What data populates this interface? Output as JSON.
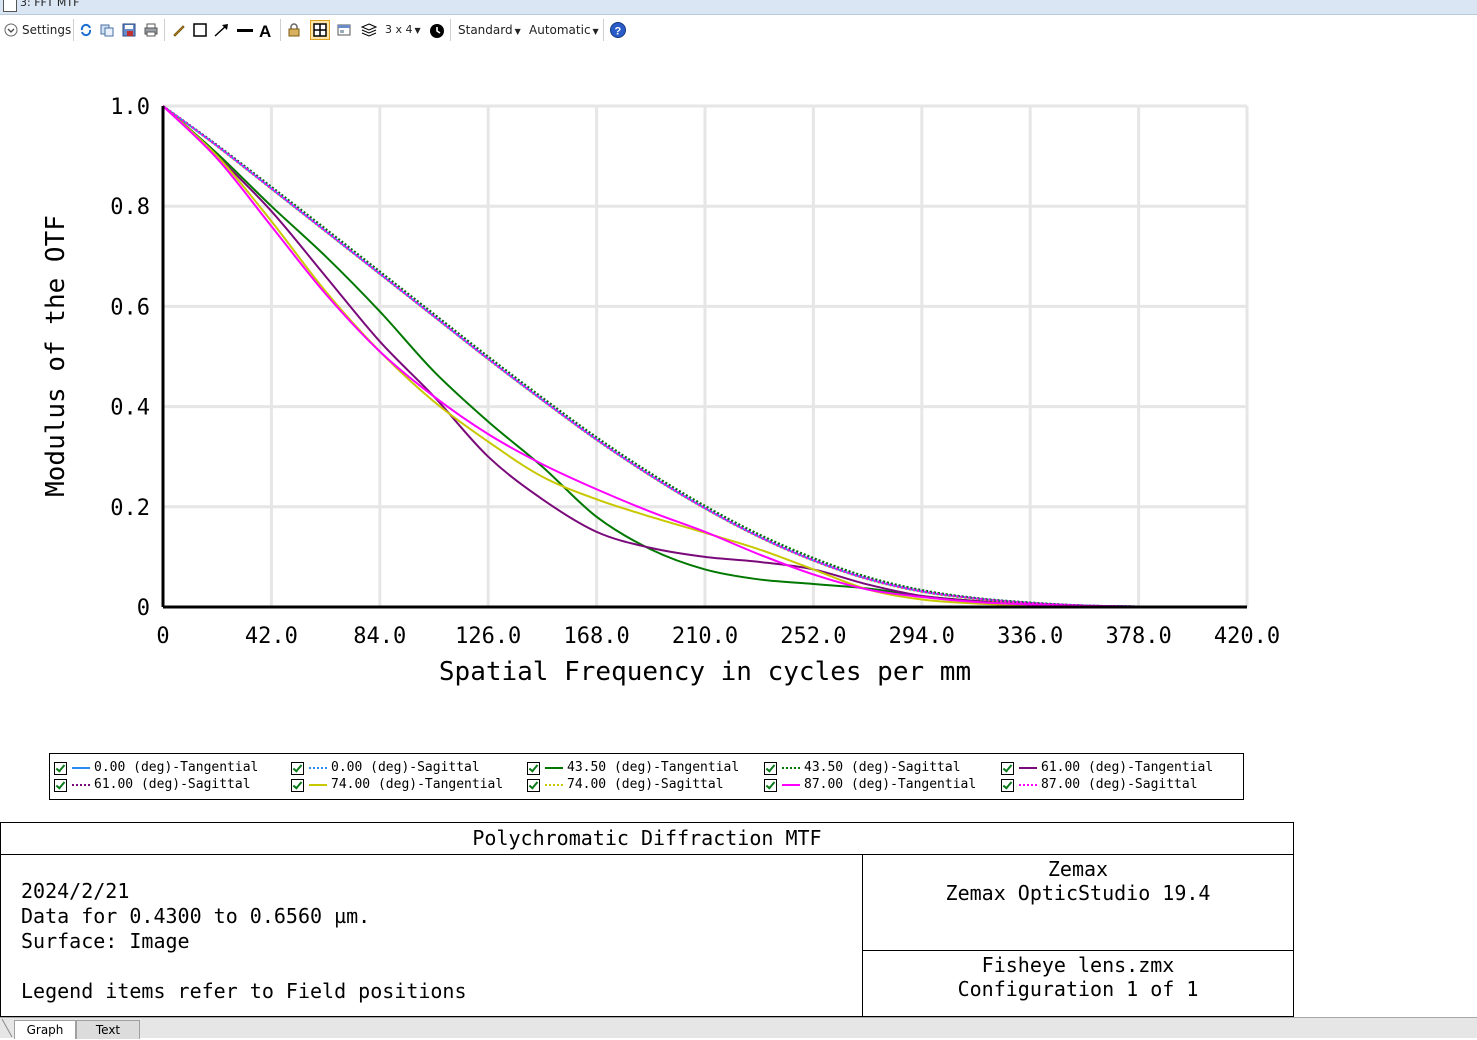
{
  "window": {
    "title": "3: FFT MTF"
  },
  "toolbar": {
    "settings_label": "Settings",
    "layout_label": "3 x 4",
    "standard_label": "Standard",
    "automatic_label": "Automatic"
  },
  "chart_data": {
    "type": "line",
    "xlabel": "Spatial Frequency in cycles per mm",
    "ylabel": "Modulus of the OTF",
    "xlim": [
      0,
      420
    ],
    "ylim": [
      0,
      1.0
    ],
    "x_ticks": [
      "0",
      "42.0",
      "84.0",
      "126.0",
      "168.0",
      "210.0",
      "252.0",
      "294.0",
      "336.0",
      "378.0",
      "420.0"
    ],
    "y_ticks": [
      "0",
      "0.2",
      "0.4",
      "0.6",
      "0.8",
      "1.0"
    ],
    "grid": true,
    "x": [
      0,
      21,
      42,
      63,
      84,
      105,
      126,
      147,
      168,
      189,
      210,
      231,
      252,
      273,
      294,
      315,
      336,
      357,
      378,
      399,
      420
    ],
    "series": [
      {
        "name": "0.00 (deg)-Tangential",
        "color": "#2a8cf0",
        "dash": "solid",
        "values": [
          1.0,
          0.92,
          0.835,
          0.75,
          0.665,
          0.58,
          0.495,
          0.413,
          0.334,
          0.262,
          0.197,
          0.14,
          0.093,
          0.056,
          0.031,
          0.017,
          0.008,
          0.003,
          0.001,
          0.0,
          0.0
        ]
      },
      {
        "name": "0.00 (deg)-Sagittal",
        "color": "#2a8cf0",
        "dash": "dotted",
        "values": [
          1.0,
          0.921,
          0.837,
          0.752,
          0.668,
          0.583,
          0.498,
          0.416,
          0.337,
          0.265,
          0.2,
          0.143,
          0.096,
          0.059,
          0.033,
          0.018,
          0.009,
          0.003,
          0.001,
          0.0,
          0.0
        ]
      },
      {
        "name": "43.50 (deg)-Tangential",
        "color": "#007800",
        "dash": "solid",
        "values": [
          1.0,
          0.905,
          0.8,
          0.7,
          0.59,
          0.47,
          0.37,
          0.28,
          0.18,
          0.115,
          0.075,
          0.055,
          0.046,
          0.037,
          0.022,
          0.012,
          0.006,
          0.002,
          0.0,
          0.0,
          0.0
        ]
      },
      {
        "name": "43.50 (deg)-Sagittal",
        "color": "#007800",
        "dash": "dotted",
        "values": [
          1.0,
          0.922,
          0.839,
          0.755,
          0.67,
          0.585,
          0.5,
          0.418,
          0.339,
          0.267,
          0.202,
          0.145,
          0.098,
          0.06,
          0.034,
          0.018,
          0.009,
          0.003,
          0.001,
          0.0,
          0.0
        ]
      },
      {
        "name": "61.00 (deg)-Tangential",
        "color": "#7a0a7a",
        "dash": "solid",
        "values": [
          1.0,
          0.9,
          0.79,
          0.66,
          0.53,
          0.42,
          0.3,
          0.215,
          0.15,
          0.118,
          0.1,
          0.09,
          0.075,
          0.045,
          0.022,
          0.012,
          0.006,
          0.002,
          0.0,
          0.0,
          0.0
        ]
      },
      {
        "name": "61.00 (deg)-Sagittal",
        "color": "#7a0a7a",
        "dash": "dotted",
        "values": [
          1.0,
          0.921,
          0.836,
          0.751,
          0.666,
          0.581,
          0.496,
          0.414,
          0.335,
          0.263,
          0.198,
          0.141,
          0.094,
          0.057,
          0.032,
          0.017,
          0.008,
          0.003,
          0.001,
          0.0,
          0.0
        ]
      },
      {
        "name": "74.00 (deg)-Tangential",
        "color": "#c8c800",
        "dash": "solid",
        "values": [
          1.0,
          0.9,
          0.77,
          0.63,
          0.51,
          0.41,
          0.33,
          0.26,
          0.215,
          0.18,
          0.148,
          0.115,
          0.075,
          0.035,
          0.015,
          0.007,
          0.003,
          0.001,
          0.0,
          0.0,
          0.0
        ]
      },
      {
        "name": "74.00 (deg)-Sagittal",
        "color": "#c8c800",
        "dash": "dotted",
        "values": [
          1.0,
          0.919,
          0.834,
          0.749,
          0.664,
          0.579,
          0.494,
          0.412,
          0.333,
          0.261,
          0.196,
          0.139,
          0.092,
          0.055,
          0.03,
          0.016,
          0.007,
          0.002,
          0.0,
          0.0,
          0.0
        ]
      },
      {
        "name": "87.00 (deg)-Tangential",
        "color": "#ff00ff",
        "dash": "solid",
        "values": [
          1.0,
          0.895,
          0.76,
          0.625,
          0.51,
          0.42,
          0.345,
          0.285,
          0.235,
          0.19,
          0.15,
          0.105,
          0.065,
          0.035,
          0.02,
          0.01,
          0.005,
          0.002,
          0.001,
          0.0,
          0.0
        ]
      },
      {
        "name": "87.00 (deg)-Sagittal",
        "color": "#ff00ff",
        "dash": "dotted",
        "values": [
          1.0,
          0.92,
          0.835,
          0.75,
          0.665,
          0.58,
          0.495,
          0.413,
          0.334,
          0.262,
          0.197,
          0.14,
          0.093,
          0.056,
          0.031,
          0.017,
          0.008,
          0.003,
          0.001,
          0.0,
          0.0
        ]
      }
    ]
  },
  "info": {
    "title": "Polychromatic Diffraction MTF",
    "date": "2024/2/21",
    "data_range": "Data for 0.4300 to 0.6560 µm.",
    "surface": "Surface: Image",
    "legend_note": "Legend items refer to Field positions",
    "vendor": "Zemax",
    "product": "Zemax OpticStudio 19.4",
    "file": "Fisheye lens.zmx",
    "configuration": "Configuration 1 of 1"
  },
  "tabs": [
    {
      "label": "Graph"
    },
    {
      "label": "Text"
    }
  ]
}
